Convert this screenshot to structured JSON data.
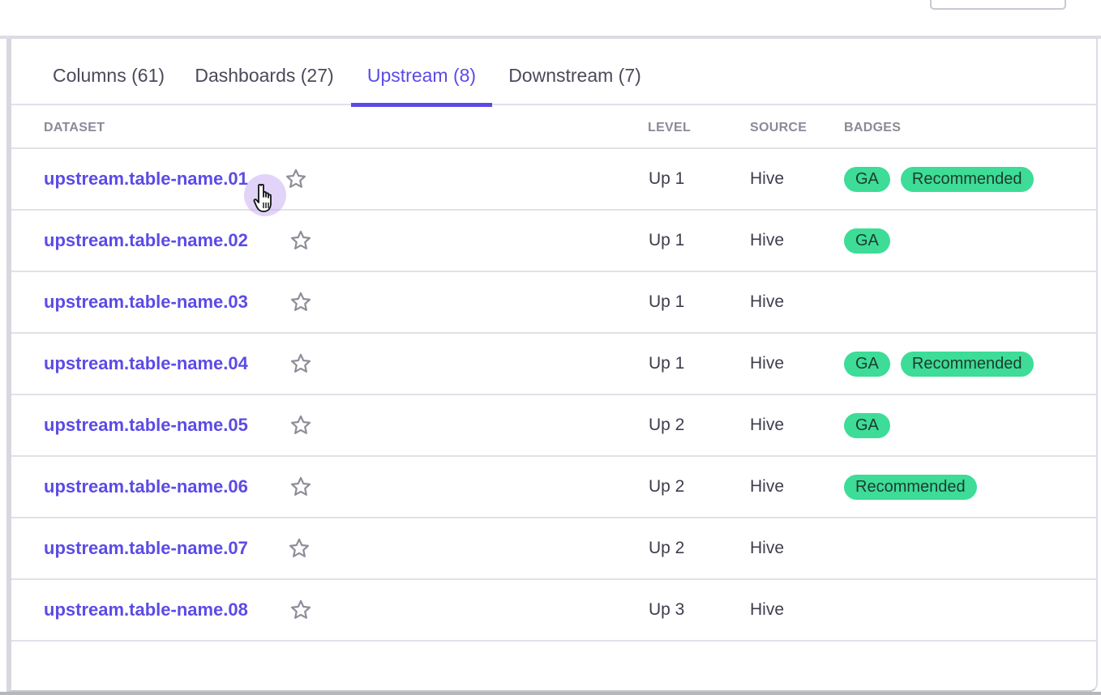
{
  "tabs": [
    {
      "label": "Columns (61)"
    },
    {
      "label": "Dashboards (27)"
    },
    {
      "label": "Upstream (8)"
    },
    {
      "label": "Downstream (7)"
    }
  ],
  "active_tab": "Upstream (8)",
  "table": {
    "headers": {
      "dataset": "DATASET",
      "level": "LEVEL",
      "source": "SOURCE",
      "badges": "BADGES"
    },
    "rows": [
      {
        "dataset": "upstream.table-name.01",
        "level": "Up 1",
        "source": "Hive",
        "badges": [
          "GA",
          "Recommended"
        ],
        "starred": false
      },
      {
        "dataset": "upstream.table-name.02",
        "level": "Up 1",
        "source": "Hive",
        "badges": [
          "GA"
        ],
        "starred": false
      },
      {
        "dataset": "upstream.table-name.03",
        "level": "Up 1",
        "source": "Hive",
        "badges": [],
        "starred": false
      },
      {
        "dataset": "upstream.table-name.04",
        "level": "Up 1",
        "source": "Hive",
        "badges": [
          "GA",
          "Recommended"
        ],
        "starred": false
      },
      {
        "dataset": "upstream.table-name.05",
        "level": "Up 2",
        "source": "Hive",
        "badges": [
          "GA"
        ],
        "starred": false
      },
      {
        "dataset": "upstream.table-name.06",
        "level": "Up 2",
        "source": "Hive",
        "badges": [
          "Recommended"
        ],
        "starred": false
      },
      {
        "dataset": "upstream.table-name.07",
        "level": "Up 2",
        "source": "Hive",
        "badges": [],
        "starred": false
      },
      {
        "dataset": "upstream.table-name.08",
        "level": "Up 3",
        "source": "Hive",
        "badges": [],
        "starred": false
      }
    ]
  },
  "icons": {
    "favorite": "star-outline-icon",
    "pointer": "hand-pointer-icon"
  },
  "colors": {
    "accent": "#5b4be6",
    "badge": "#3ddc97",
    "badge_text": "#1e3b2f",
    "star": "#8e8e9a"
  }
}
